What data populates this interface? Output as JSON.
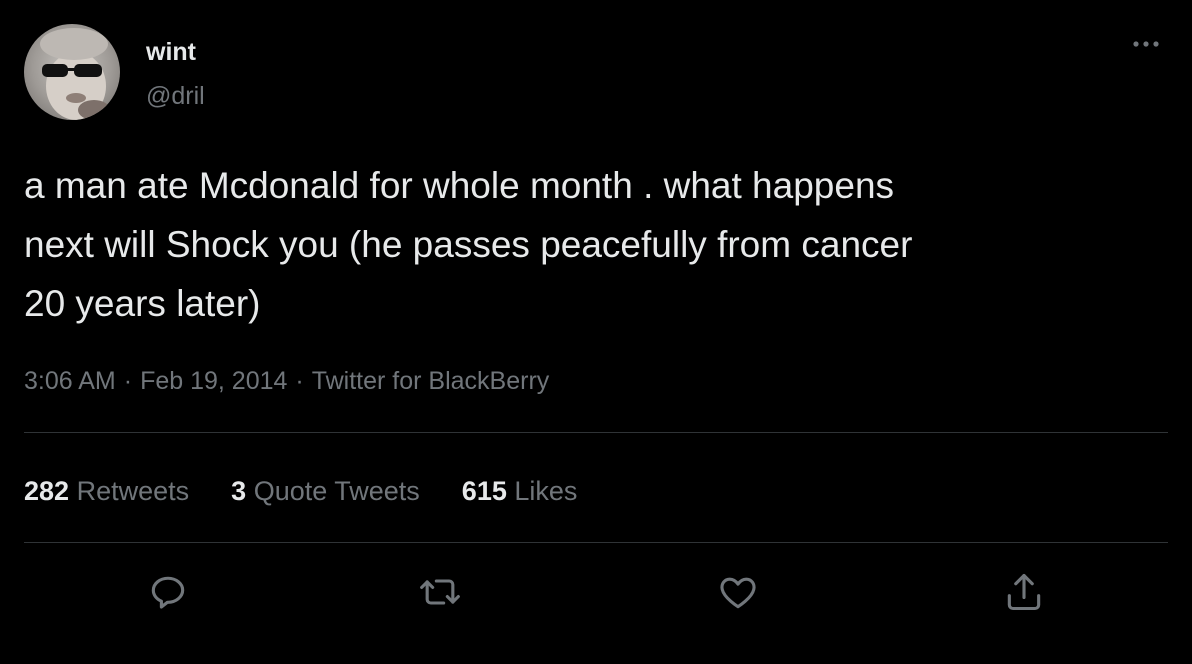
{
  "author": {
    "display_name": "wint",
    "handle": "@dril"
  },
  "tweet": {
    "text": "a man ate Mcdonald for whole month .  what happens\nnext will Shock you (he passes peacefully from cancer\n20 years later)",
    "time": "3:06 AM",
    "date": "Feb 19, 2014",
    "source": "Twitter for BlackBerry",
    "separator": "·"
  },
  "stats": {
    "retweets_count": "282",
    "retweets_label": "Retweets",
    "quotes_count": "3",
    "quotes_label": "Quote Tweets",
    "likes_count": "615",
    "likes_label": "Likes"
  },
  "actions": {
    "reply_icon": "reply-icon",
    "retweet_icon": "retweet-icon",
    "like_icon": "heart-icon",
    "share_icon": "share-icon",
    "more_icon": "more-icon"
  },
  "colors": {
    "background": "#000000",
    "primary_text": "#e7e9ea",
    "secondary_text": "#71767b",
    "divider": "#2f3336"
  }
}
